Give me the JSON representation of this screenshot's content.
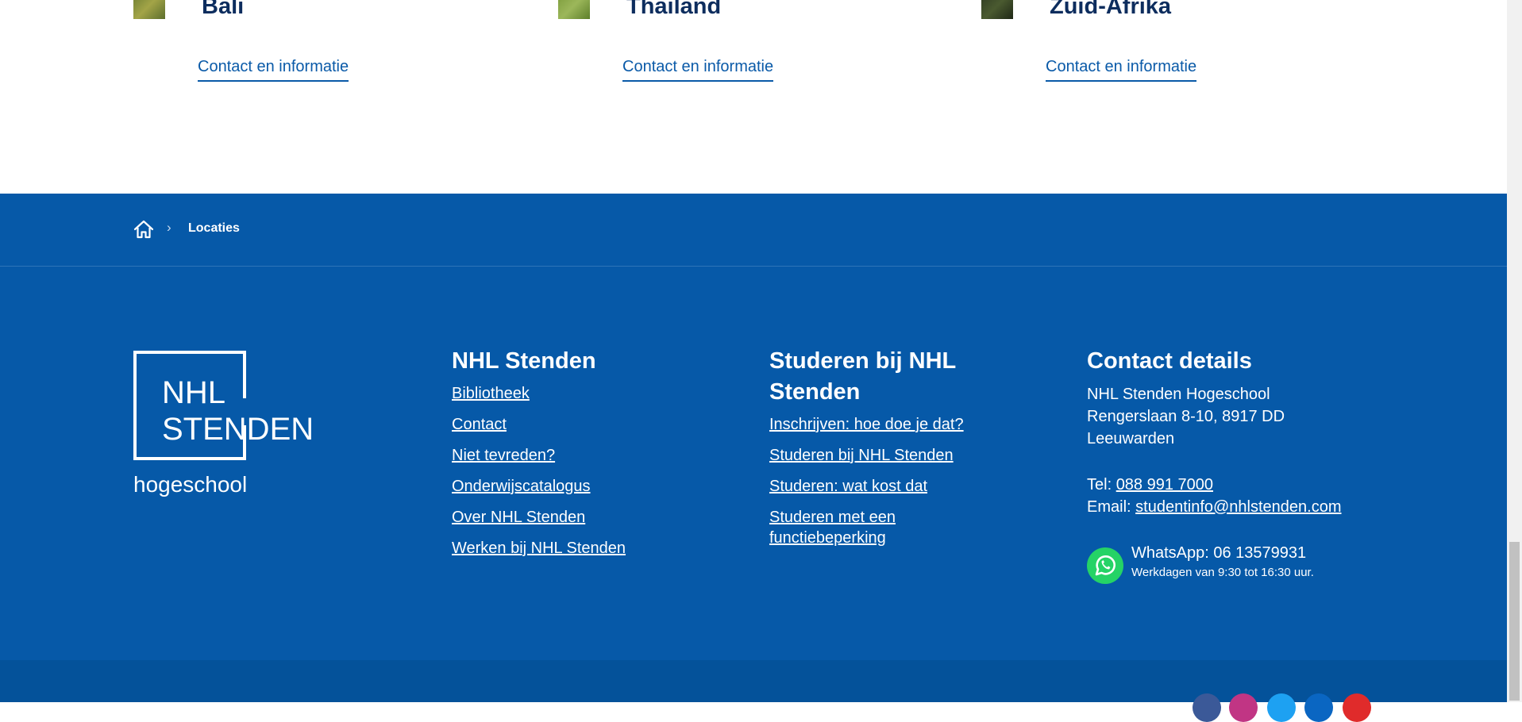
{
  "locations": [
    {
      "name": "Bali",
      "link": "Contact en informatie"
    },
    {
      "name": "Thailand",
      "link": "Contact en informatie"
    },
    {
      "name": "Zuid-Afrika",
      "link": "Contact en informatie"
    }
  ],
  "breadcrumb": {
    "home_icon": "home-icon",
    "separator": "›",
    "current": "Locaties"
  },
  "logo": {
    "line1": "NHL",
    "line2": "STENDEN",
    "line3": "hogeschool"
  },
  "footer": {
    "col_nhl": {
      "title": "NHL Stenden",
      "links": [
        "Bibliotheek",
        "Contact",
        "Niet tevreden?",
        "Onderwijscatalogus",
        "Over NHL Stenden",
        "Werken bij NHL Stenden"
      ]
    },
    "col_studeren": {
      "title": "Studeren bij NHL Stenden",
      "links": [
        "Inschrijven: hoe doe je dat?",
        "Studeren bij NHL Stenden",
        "Studeren: wat kost dat",
        "Studeren met een functiebeperking"
      ]
    },
    "contact": {
      "title": "Contact details",
      "address_line1": "NHL Stenden Hogeschool",
      "address_line2": "Rengerslaan 8-10, 8917 DD",
      "address_line3": "Leeuwarden",
      "tel_label": "Tel:",
      "tel_value": "088 991 7000",
      "email_label": "Email:",
      "email_value": "studentinfo@nhlstenden.com",
      "whatsapp_title": "WhatsApp: 06 13579931",
      "whatsapp_sub": "Werkdagen van 9:30 tot 16:30 uur.",
      "whatsapp_icon": "whatsapp-icon"
    }
  },
  "social": [
    {
      "icon": "facebook-icon",
      "color": "#3b5998"
    },
    {
      "icon": "instagram-icon",
      "color": "#c13584"
    },
    {
      "icon": "twitter-icon",
      "color": "#1da1f2"
    },
    {
      "icon": "linkedin-icon",
      "color": "#0a66c2"
    },
    {
      "icon": "youtube-icon",
      "color": "#e02b2b"
    }
  ],
  "colors": {
    "footer_bg": "#0659a8",
    "bottom_bar_bg": "#04529a",
    "heading_dark": "#0d2d5e",
    "link_blue": "#0a5aa8"
  }
}
